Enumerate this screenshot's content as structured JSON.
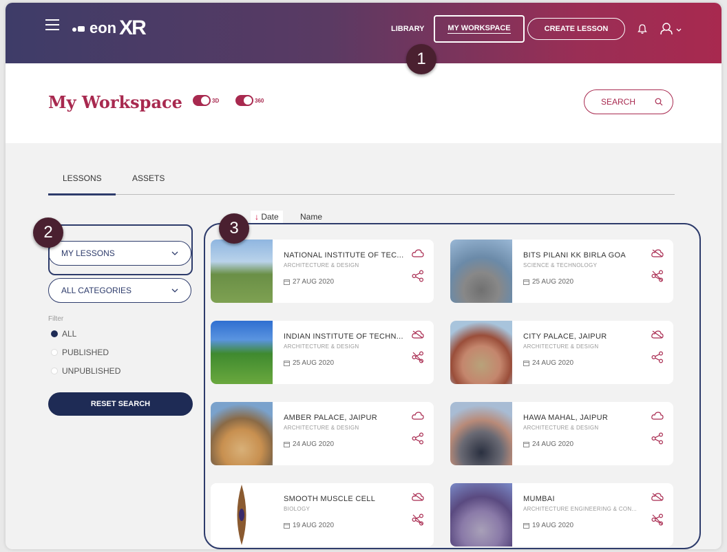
{
  "header": {
    "logo_text_eon": "eon",
    "logo_text_xr": "XR",
    "nav": {
      "library": "LIBRARY",
      "my_workspace": "MY WORKSPACE",
      "create_lesson": "CREATE LESSON"
    }
  },
  "badges": {
    "one": "1",
    "two": "2",
    "three": "3"
  },
  "page": {
    "title": "My Workspace",
    "toggle_3d": "3D",
    "toggle_360": "360",
    "search_placeholder": "SEARCH"
  },
  "tabs": [
    {
      "label": "LESSONS"
    },
    {
      "label": "ASSETS"
    }
  ],
  "sidebar": {
    "dropdown_lessons": "MY LESSONS",
    "dropdown_categories": "ALL CATEGORIES",
    "filter_label": "Filter",
    "filters": [
      {
        "label": "ALL",
        "selected": true
      },
      {
        "label": "PUBLISHED",
        "selected": false
      },
      {
        "label": "UNPUBLISHED",
        "selected": false
      }
    ],
    "reset_button": "RESET SEARCH"
  },
  "sort": {
    "date": "Date",
    "name": "Name"
  },
  "cards": [
    {
      "title": "NATIONAL INSTITUTE OF TEC...",
      "category": "ARCHITECTURE & DESIGN",
      "date": "27 AUG 2020",
      "published": true
    },
    {
      "title": "BITS PILANI KK BIRLA GOA",
      "category": "SCIENCE & TECHNOLOGY",
      "date": "25 AUG 2020",
      "published": false
    },
    {
      "title": "INDIAN INSTITUTE OF TECHN...",
      "category": "ARCHITECTURE & DESIGN",
      "date": "25 AUG 2020",
      "published": false
    },
    {
      "title": "CITY PALACE, JAIPUR",
      "category": "ARCHITECTURE & DESIGN",
      "date": "24 AUG 2020",
      "published": false
    },
    {
      "title": "AMBER PALACE, JAIPUR",
      "category": "ARCHITECTURE & DESIGN",
      "date": "24 AUG 2020",
      "published": true
    },
    {
      "title": "HAWA MAHAL, JAIPUR",
      "category": "ARCHITECTURE & DESIGN",
      "date": "24 AUG 2020",
      "published": true
    },
    {
      "title": "SMOOTH MUSCLE CELL",
      "category": "BIOLOGY",
      "date": "19 AUG 2020",
      "published": false
    },
    {
      "title": "MUMBAI",
      "category": "ARCHITECTURE ENGINEERING & CON...",
      "date": "19 AUG 2020",
      "published": false
    }
  ],
  "colors": {
    "accent": "#a8294f",
    "navy": "#1e2b55"
  }
}
